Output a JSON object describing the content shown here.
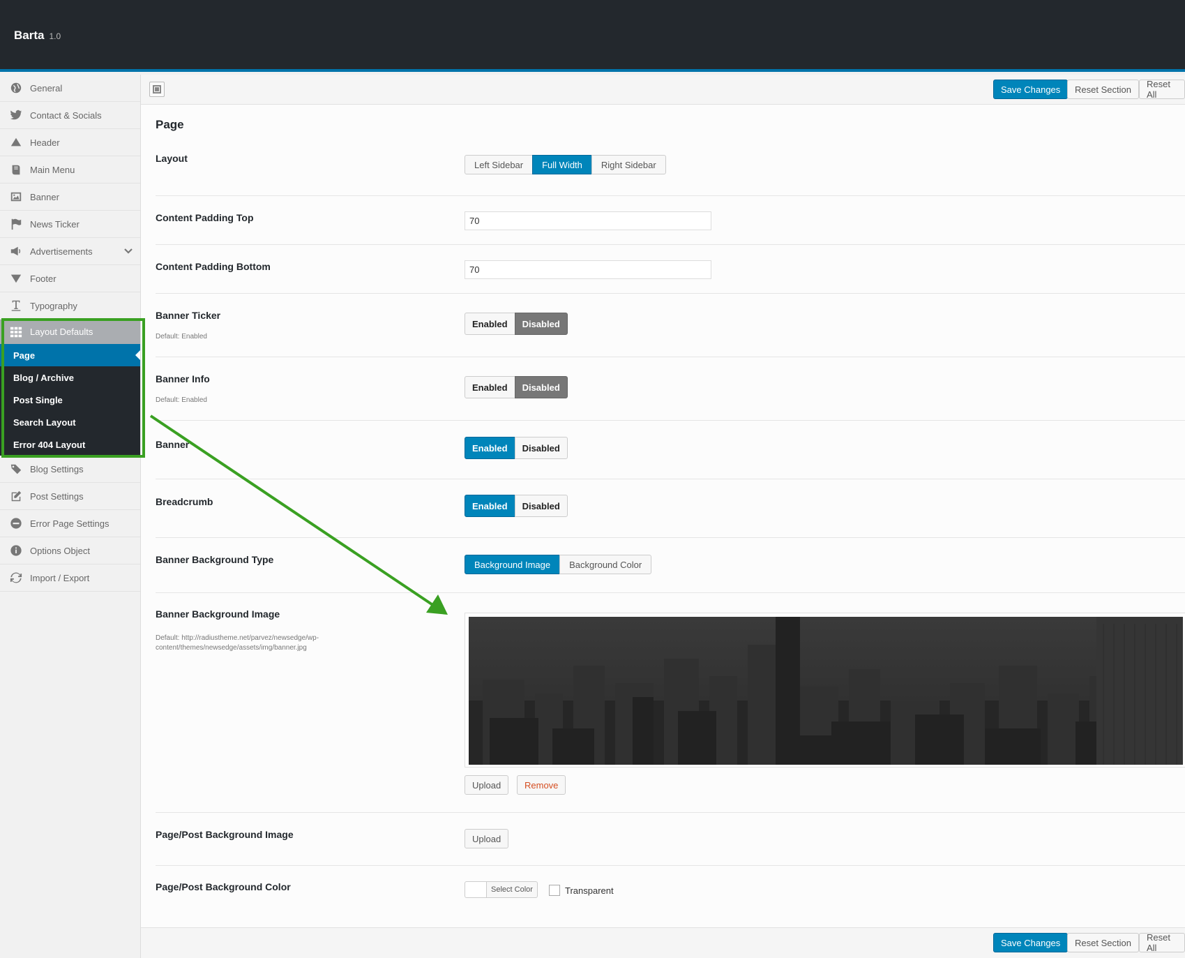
{
  "app": {
    "title": "Barta",
    "version": "1.0"
  },
  "sidebar": {
    "items": [
      {
        "label": "General",
        "icon": "globe-icon"
      },
      {
        "label": "Contact & Socials",
        "icon": "twitter-icon"
      },
      {
        "label": "Header",
        "icon": "triangle-up-icon"
      },
      {
        "label": "Main Menu",
        "icon": "book-icon"
      },
      {
        "label": "Banner",
        "icon": "image-icon"
      },
      {
        "label": "News Ticker",
        "icon": "flag-icon"
      },
      {
        "label": "Advertisements",
        "icon": "megaphone-icon"
      },
      {
        "label": "Footer",
        "icon": "triangle-down-icon"
      },
      {
        "label": "Typography",
        "icon": "text-icon"
      },
      {
        "label": "Layout Defaults",
        "icon": "grid-icon"
      }
    ],
    "submenu": [
      "Page",
      "Blog / Archive",
      "Post Single",
      "Search Layout",
      "Error 404 Layout"
    ],
    "items_after": [
      {
        "label": "Blog Settings",
        "icon": "tags-icon"
      },
      {
        "label": "Post Settings",
        "icon": "edit-icon"
      },
      {
        "label": "Error Page Settings",
        "icon": "minus-circle-icon"
      },
      {
        "label": "Options Object",
        "icon": "info-icon"
      },
      {
        "label": "Import / Export",
        "icon": "refresh-icon"
      }
    ]
  },
  "toolbar": {
    "save": "Save Changes",
    "reset_section": "Reset Section",
    "reset_all": "Reset All"
  },
  "section": {
    "title": "Page"
  },
  "fields": {
    "layout": {
      "label": "Layout",
      "options": [
        "Left Sidebar",
        "Full Width",
        "Right Sidebar"
      ],
      "selected": "Full Width"
    },
    "padding_top": {
      "label": "Content Padding Top",
      "value": "70"
    },
    "padding_bottom": {
      "label": "Content Padding Bottom",
      "value": "70"
    },
    "banner_ticker": {
      "label": "Banner Ticker",
      "desc": "Default: Enabled",
      "on": "Enabled",
      "off": "Disabled",
      "selected": "Disabled"
    },
    "banner_info": {
      "label": "Banner Info",
      "desc": "Default: Enabled",
      "on": "Enabled",
      "off": "Disabled",
      "selected": "Disabled"
    },
    "banner": {
      "label": "Banner",
      "on": "Enabled",
      "off": "Disabled",
      "selected": "Enabled"
    },
    "breadcrumb": {
      "label": "Breadcrumb",
      "on": "Enabled",
      "off": "Disabled",
      "selected": "Enabled"
    },
    "banner_bg_type": {
      "label": "Banner Background Type",
      "options": [
        "Background Image",
        "Background Color"
      ],
      "selected": "Background Image"
    },
    "banner_bg_image": {
      "label": "Banner Background Image",
      "desc": "Default: http://radiustheme.net/parvez/newsedge/wp-content/themes/newsedge/assets/img/banner.jpg",
      "upload": "Upload",
      "remove": "Remove"
    },
    "page_bg_image": {
      "label": "Page/Post Background Image",
      "upload": "Upload"
    },
    "page_bg_color": {
      "label": "Page/Post Background Color",
      "select": "Select Color",
      "transparent": "Transparent"
    }
  },
  "colors": {
    "accent": "#0085ba",
    "sidebar_dark": "#23282d",
    "annotation": "#3aa022"
  }
}
